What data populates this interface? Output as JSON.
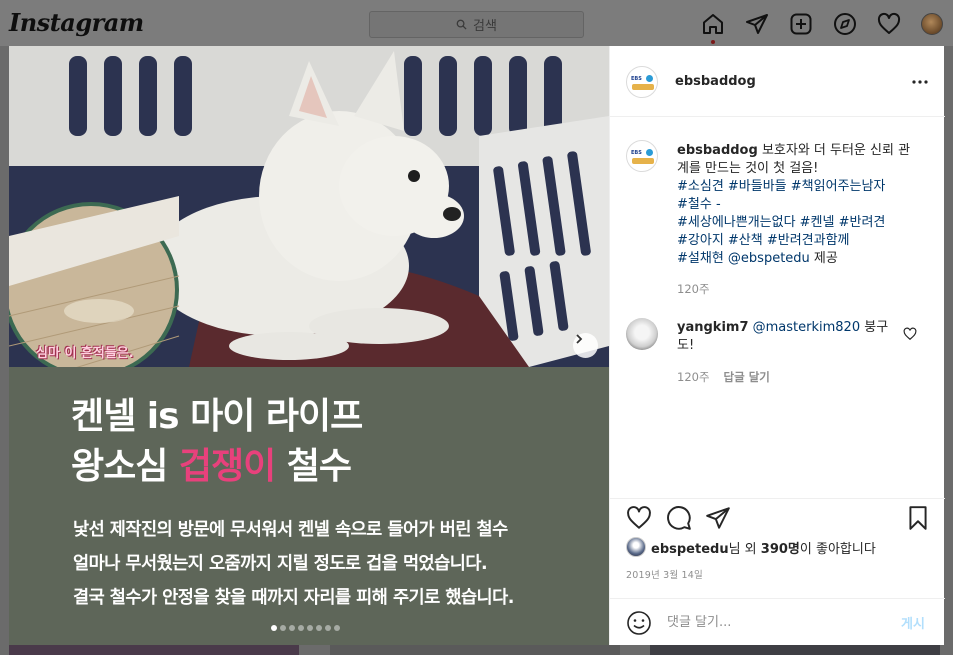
{
  "app": {
    "logo": "Instagram"
  },
  "nav": {
    "search_placeholder": "검색",
    "icons": [
      "home-icon",
      "direct-icon",
      "new-post-icon",
      "explore-icon",
      "activity-icon",
      "profile-avatar"
    ]
  },
  "post": {
    "image": {
      "headline_line1": "켄넬 is 마이 라이프",
      "headline_line2_before": "왕소심 ",
      "headline_line2_highlight": "겁쟁이",
      "headline_line2_after": " 철수",
      "body": [
        "낯선 제작진의 방문에 무서워서 켄넬 속으로 들어가 버린 철수",
        "얼마나 무서웠는지 오줌까지 지릴 정도로 겁을 먹었습니다.",
        "결국 철수가 안정을 찾을 때까지 자리를 피해 주기로 했습니다."
      ],
      "inset_caption": "심마 이 흔적들은.",
      "carousel_count": 8,
      "carousel_active": 0
    },
    "header": {
      "username": "ebsbaddog",
      "avatar_text": "EBS"
    },
    "caption": {
      "username": "ebsbaddog",
      "text": "보호자와 더 두터운 신뢰 관계를 만드는 것이 첫 걸음!",
      "hashtags_line1": "#소심견 #바들바들 #책읽어주는남자",
      "line2": "#철수 -",
      "hashtags_line3": "#세상에나쁜개는없다 #켄넬 #반려견",
      "hashtags_line4": "#강아지 #산책 #반려견과함께",
      "credit_tag": "#설채현",
      "credit_mention": "@ebspetedu",
      "credit_suffix": "제공",
      "time": "120주"
    },
    "comment": {
      "username": "yangkim7",
      "mention": "@masterkim820",
      "text": "붕구도!",
      "time": "120주",
      "reply_label": "답글 달기"
    },
    "likes": {
      "user": "ebspetedu",
      "middle": "님 외",
      "count": "390명",
      "suffix": "이 좋아합니다"
    },
    "date": "2019년 3월 14일",
    "add_comment": {
      "placeholder": "댓글 달기...",
      "post_label": "게시"
    }
  },
  "colors": {
    "text_panel": "#5e6659",
    "highlight_pink": "#e8417c",
    "link": "#00376b",
    "post_button": "#b2dffc"
  }
}
